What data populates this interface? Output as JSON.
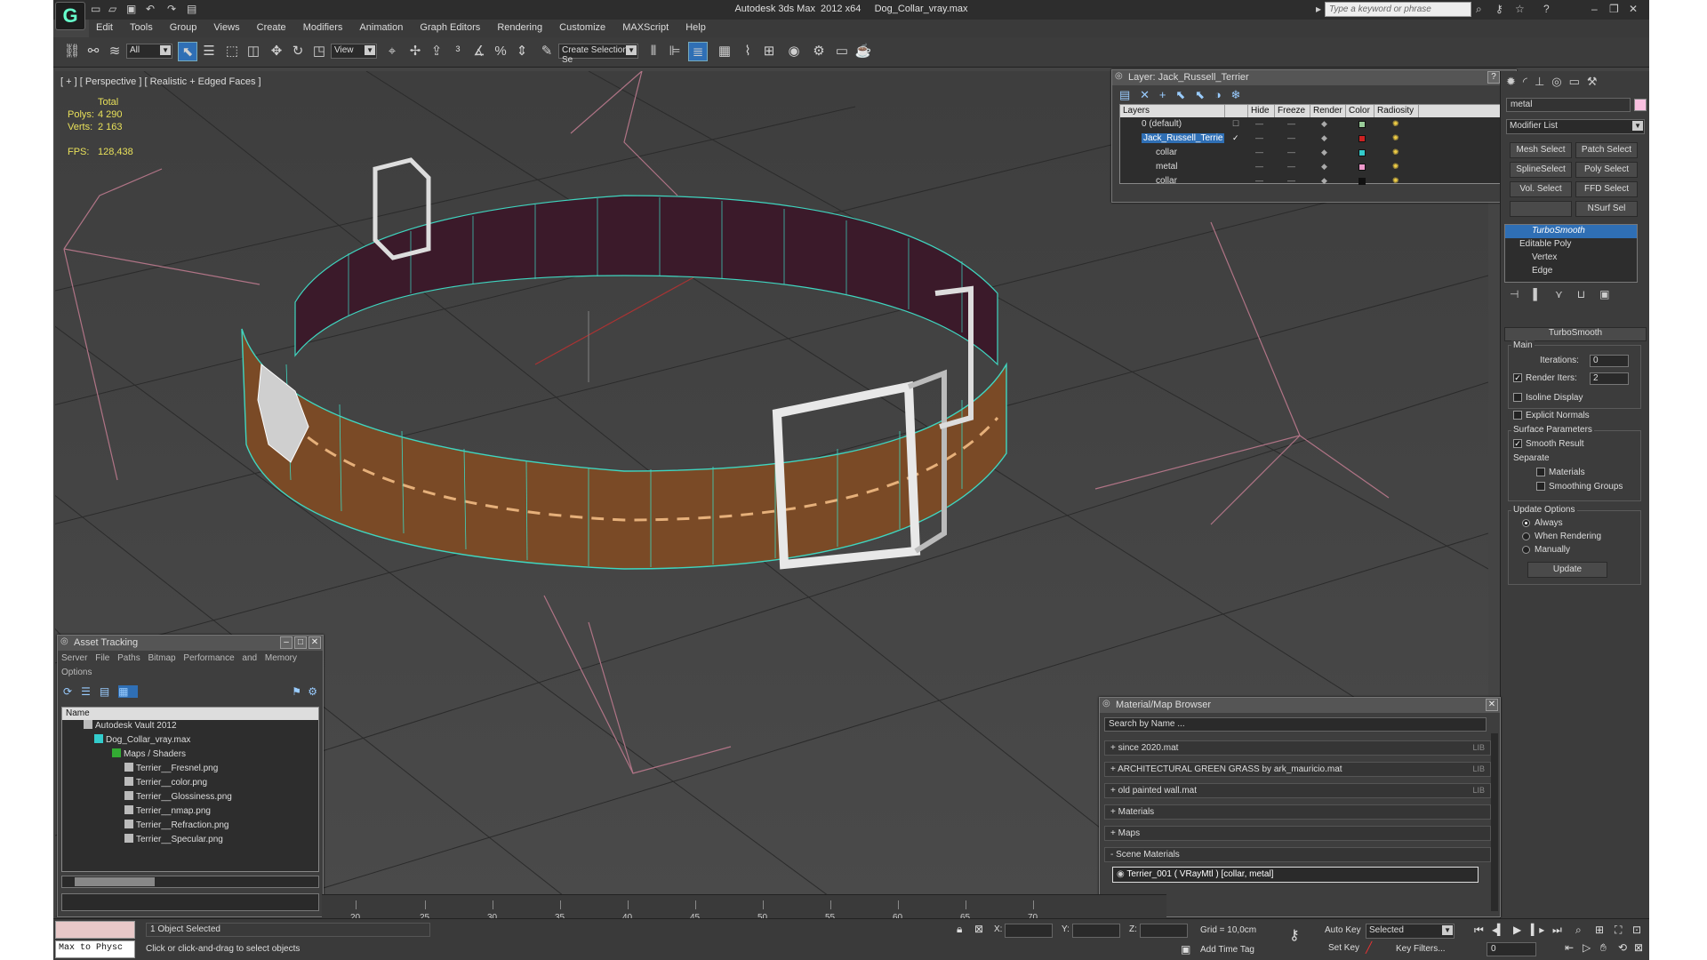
{
  "app": {
    "title": "Autodesk 3ds Max  2012 x64     Dog_Collar_vray.max",
    "search_placeholder": "Type a keyword or phrase"
  },
  "menu": [
    "Edit",
    "Tools",
    "Group",
    "Views",
    "Create",
    "Modifiers",
    "Animation",
    "Graph Editors",
    "Rendering",
    "Customize",
    "MAXScript",
    "Help"
  ],
  "toolbar": {
    "selection_filter": "All",
    "ref_coord": "View",
    "named_selection": "Create Selection Se"
  },
  "viewport": {
    "label": "[ + ] [ Perspective ] [ Realistic + Edged Faces ]",
    "stats_total": "Total",
    "polys_label": "Polys:",
    "polys": "4 290",
    "verts_label": "Verts:",
    "verts": "2 163",
    "fps_label": "FPS:",
    "fps": "128,438"
  },
  "layer_window": {
    "title": "Layer: Jack_Russell_Terrier",
    "columns": [
      "Layers",
      "Hide",
      "Freeze",
      "Render",
      "Color",
      "Radiosity"
    ],
    "rows": [
      {
        "name": "0 (default)",
        "color": "#9c9"
      },
      {
        "name": "Jack_Russell_Terrie",
        "color": "#c22"
      },
      {
        "name": "collar",
        "color": "#3cc"
      },
      {
        "name": "metal",
        "color": "#e9c"
      },
      {
        "name": "collar",
        "color": "#111"
      }
    ]
  },
  "command_panel": {
    "search": "metal",
    "modifier_list": "Modifier List",
    "buttons": [
      "Mesh Select",
      "Patch Select",
      "SplineSelect",
      "Poly Select",
      "Vol. Select",
      "FFD Select",
      "NSurf Sel"
    ],
    "stack": [
      "TurboSmooth",
      "Editable Poly",
      "Vertex",
      "Edge"
    ],
    "rollout_title": "TurboSmooth",
    "main": "Main",
    "iterations_label": "Iterations:",
    "iterations": "0",
    "render_iters_label": "Render Iters:",
    "render_iters": "2",
    "isoline": "Isoline Display",
    "explicit_normals": "Explicit Normals",
    "surface_params": "Surface Parameters",
    "smooth_result": "Smooth Result",
    "separate": "Separate",
    "materials": "Materials",
    "smoothing_groups": "Smoothing Groups",
    "update_options": "Update Options",
    "always": "Always",
    "when_rendering": "When Rendering",
    "manually": "Manually",
    "update": "Update"
  },
  "asset_tracking": {
    "title": "Asset Tracking",
    "menu": [
      "Server",
      "File",
      "Paths",
      "Bitmap Performance and Memory"
    ],
    "options": "Options",
    "col_name": "Name",
    "items": [
      {
        "name": "Autodesk Vault 2012",
        "indent": 1
      },
      {
        "name": "Dog_Collar_vray.max",
        "indent": 2
      },
      {
        "name": "Maps / Shaders",
        "indent": 3
      },
      {
        "name": "Terrier__Fresnel.png",
        "indent": 4
      },
      {
        "name": "Terrier__color.png",
        "indent": 4
      },
      {
        "name": "Terrier__Glossiness.png",
        "indent": 4
      },
      {
        "name": "Terrier__nmap.png",
        "indent": 4
      },
      {
        "name": "Terrier__Refraction.png",
        "indent": 4
      },
      {
        "name": "Terrier__Specular.png",
        "indent": 4
      }
    ]
  },
  "material_browser": {
    "title": "Material/Map Browser",
    "search": "Search by Name ...",
    "groups": [
      {
        "label": "+ since 2020.mat",
        "lib": "LIB"
      },
      {
        "label": "+ ARCHITECTURAL GREEN GRASS by ark_mauricio.mat",
        "lib": "LIB"
      },
      {
        "label": "+ old painted wall.mat",
        "lib": "LIB"
      },
      {
        "label": "+ Materials",
        "lib": ""
      },
      {
        "label": "+ Maps",
        "lib": ""
      },
      {
        "label": "- Scene Materials",
        "lib": ""
      }
    ],
    "scene_material": "Terrier_001  ( VRayMtl )  [collar, metal]"
  },
  "timeline": {
    "ticks": [
      "20",
      "25",
      "30",
      "35",
      "40",
      "45",
      "50",
      "55",
      "60",
      "65",
      "70"
    ]
  },
  "status": {
    "maxscript": "Max to Physc",
    "selected": "1 Object Selected",
    "prompt": "Click or click-and-drag to select objects",
    "x_label": "X:",
    "y_label": "Y:",
    "z_label": "Z:",
    "grid": "Grid = 10,0cm",
    "add_time_tag": "Add Time Tag",
    "auto_key": "Auto Key",
    "set_key": "Set Key",
    "key_mode": "Selected",
    "key_filters": "Key Filters...",
    "frame": "0"
  }
}
